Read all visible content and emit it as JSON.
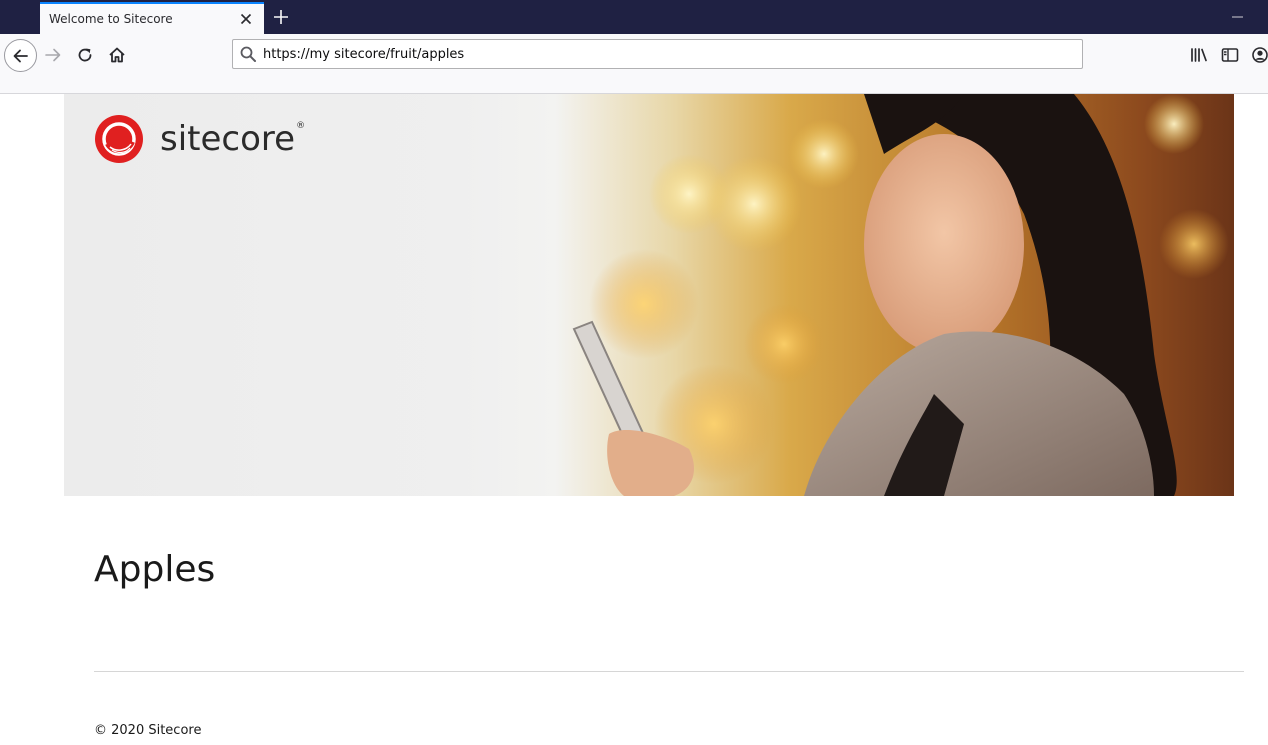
{
  "browser": {
    "tab": {
      "title": "Welcome to Sitecore",
      "close_icon": "close-icon"
    },
    "new_tab_icon": "plus-icon",
    "minimize_icon": "minimize-icon",
    "nav": {
      "back_icon": "arrow-left-icon",
      "forward_icon": "arrow-right-icon",
      "reload_icon": "reload-icon",
      "home_icon": "home-icon"
    },
    "url": {
      "value": "https://my sitecore/fruit/apples",
      "icon": "search-icon"
    },
    "toolbar_icons": [
      "library-icon",
      "sidebar-icon",
      "account-icon"
    ],
    "colors": {
      "tabstrip": "#1f2143",
      "tab_accent": "#0a84ff",
      "toolbar": "#f9f9fb"
    }
  },
  "site": {
    "logo": {
      "text": "sitecore",
      "reg_mark": "®",
      "icon": "sitecore-logo-icon",
      "brand_color": "#e02020"
    },
    "page_title": "Apples",
    "footer": "© 2020 Sitecore"
  }
}
